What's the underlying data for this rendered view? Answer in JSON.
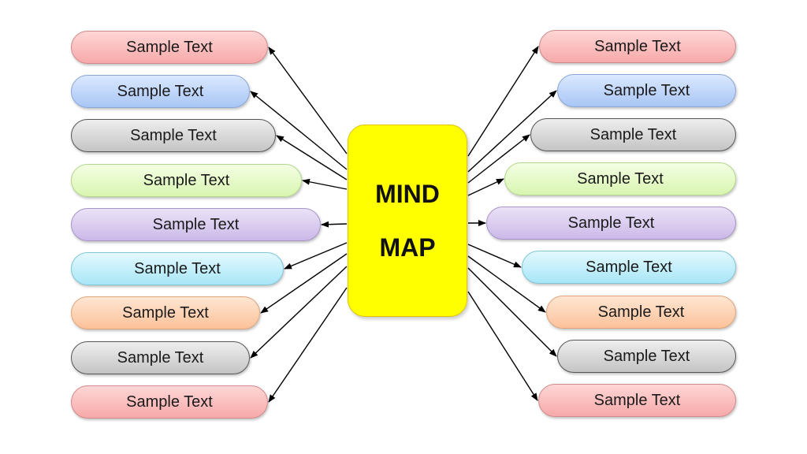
{
  "center": {
    "lines": [
      "MIND",
      "MAP"
    ],
    "color": "#ffff00"
  },
  "left_nodes": [
    {
      "label": "Sample Text",
      "color": "red"
    },
    {
      "label": "Sample Text",
      "color": "blue"
    },
    {
      "label": "Sample Text",
      "color": "gray"
    },
    {
      "label": "Sample Text",
      "color": "green"
    },
    {
      "label": "Sample Text",
      "color": "purple"
    },
    {
      "label": "Sample Text",
      "color": "cyan"
    },
    {
      "label": "Sample Text",
      "color": "orange"
    },
    {
      "label": "Sample Text",
      "color": "gray"
    },
    {
      "label": "Sample Text",
      "color": "red"
    }
  ],
  "right_nodes": [
    {
      "label": "Sample Text",
      "color": "red"
    },
    {
      "label": "Sample Text",
      "color": "blue"
    },
    {
      "label": "Sample Text",
      "color": "gray"
    },
    {
      "label": "Sample Text",
      "color": "green"
    },
    {
      "label": "Sample Text",
      "color": "purple"
    },
    {
      "label": "Sample Text",
      "color": "cyan"
    },
    {
      "label": "Sample Text",
      "color": "orange"
    },
    {
      "label": "Sample Text",
      "color": "gray"
    },
    {
      "label": "Sample Text",
      "color": "red"
    }
  ],
  "edges": {
    "from": "center",
    "arrowhead": "to-node",
    "count_left": 9,
    "count_right": 9
  }
}
